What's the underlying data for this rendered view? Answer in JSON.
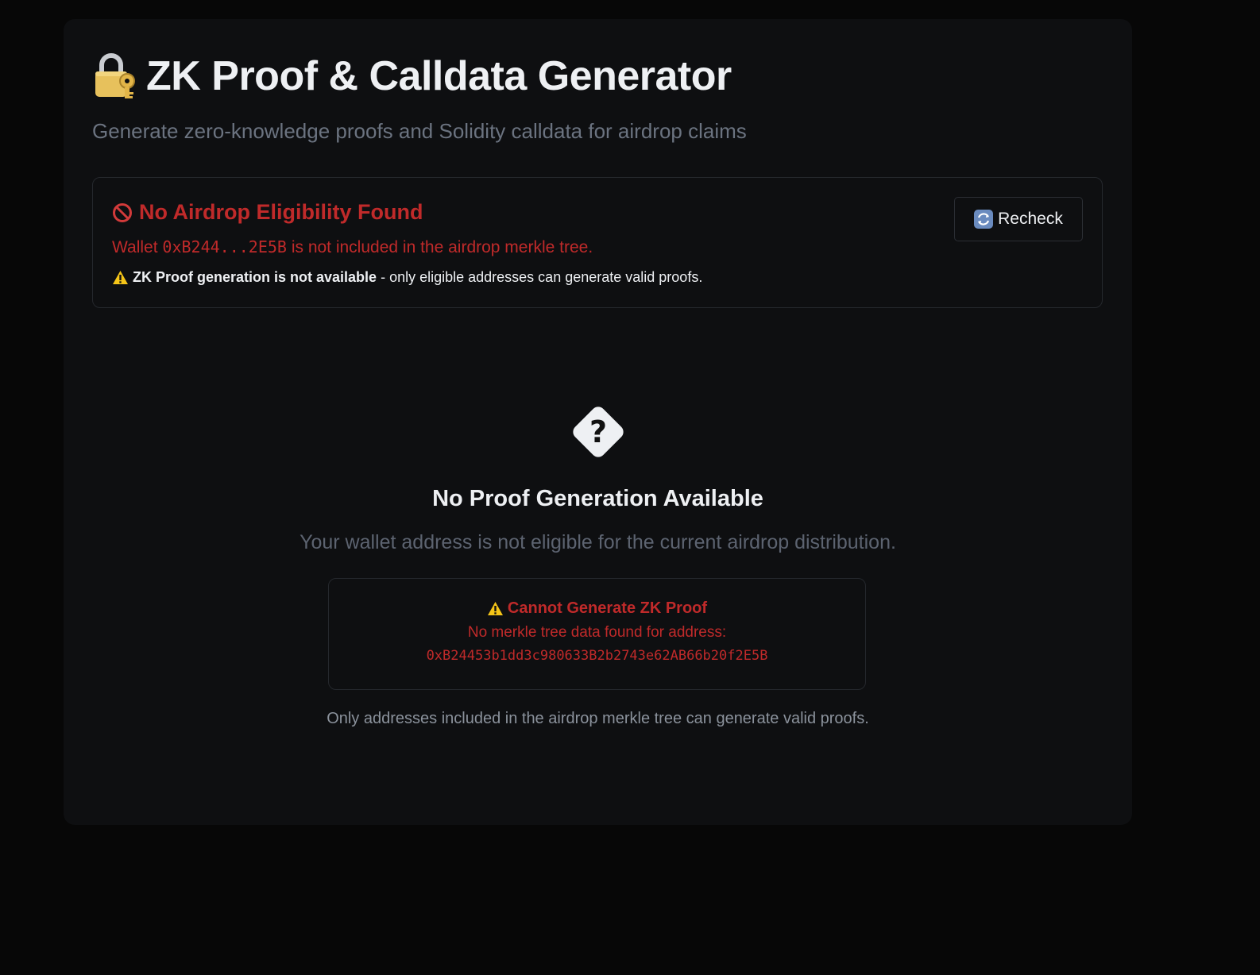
{
  "header": {
    "title": "ZK Proof & Calldata Generator",
    "subtitle": "Generate zero-knowledge proofs and Solidity calldata for airdrop claims",
    "icon": "lock-with-key-icon"
  },
  "alert": {
    "title": "No Airdrop Eligibility Found",
    "wallet_prefix": "Wallet",
    "wallet_short": "0xB244...2E5B",
    "wallet_suffix": "is not included in the airdrop merkle tree.",
    "note_bold": "ZK Proof generation is not available",
    "note_rest": "- only eligible addresses can generate valid proofs.",
    "recheck_label": "Recheck",
    "color": "#c02a2a"
  },
  "empty_state": {
    "title": "No Proof Generation Available",
    "description": "Your wallet address is not eligible for the current airdrop distribution."
  },
  "error_box": {
    "title": "Cannot Generate ZK Proof",
    "message": "No merkle tree data found for address:",
    "address": "0xB24453b1dd3c980633B2b2743e62AB66b20f2E5B"
  },
  "footnote": "Only addresses included in the airdrop merkle tree can generate valid proofs."
}
